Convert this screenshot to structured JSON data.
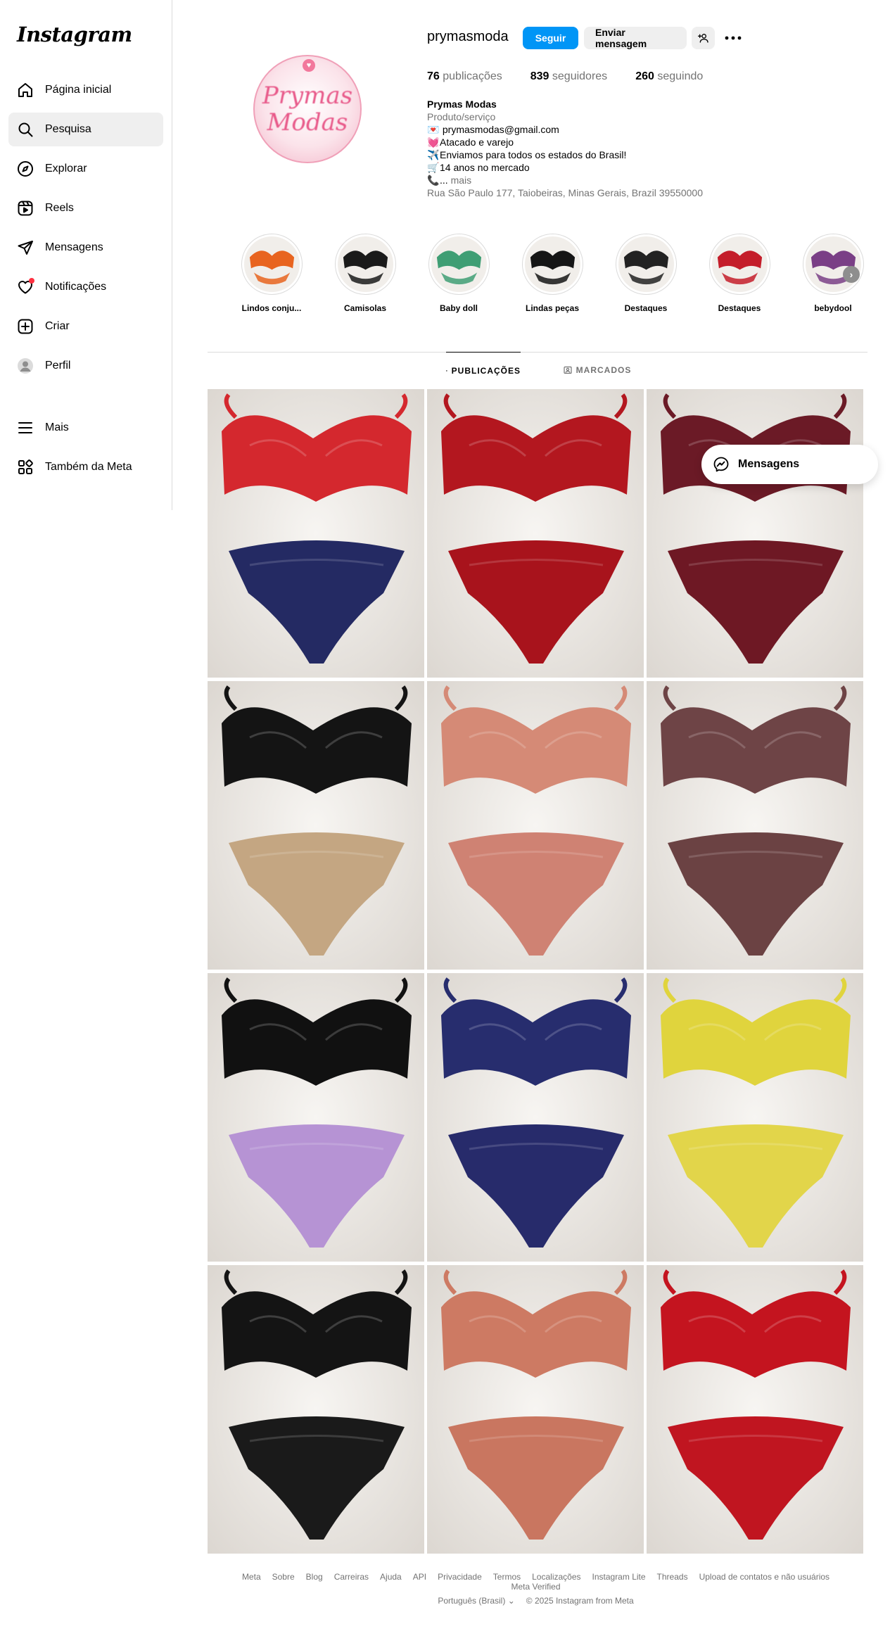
{
  "app": {
    "logo_text": "Instagram"
  },
  "sidebar": {
    "items": [
      {
        "label": "Página inicial",
        "icon": "home-icon"
      },
      {
        "label": "Pesquisa",
        "icon": "search-icon",
        "active": true
      },
      {
        "label": "Explorar",
        "icon": "compass-icon"
      },
      {
        "label": "Reels",
        "icon": "reels-icon"
      },
      {
        "label": "Mensagens",
        "icon": "paper-plane-icon"
      },
      {
        "label": "Notificações",
        "icon": "heart-icon"
      },
      {
        "label": "Criar",
        "icon": "plus-square-icon"
      },
      {
        "label": "Perfil",
        "icon": "avatar-icon"
      }
    ],
    "bottom_items": [
      {
        "label": "Mais",
        "icon": "menu-icon"
      },
      {
        "label": "Também da Meta",
        "icon": "meta-apps-icon"
      }
    ]
  },
  "profile": {
    "username": "prymasmoda",
    "avatar_text": [
      "Prymas",
      "Modas"
    ],
    "follow_label": "Seguir",
    "message_label": "Enviar mensagem",
    "stats": [
      {
        "value": "76",
        "label": "publicações"
      },
      {
        "value": "839",
        "label": "seguidores"
      },
      {
        "value": "260",
        "label": "seguindo"
      }
    ],
    "bio": {
      "name": "Prymas Modas",
      "category": "Produto/serviço",
      "lines": [
        {
          "emoji": "💌",
          "text": " prymasmodas@gmail.com"
        },
        {
          "emoji": "💓",
          "text": "Atacado e varejo"
        },
        {
          "emoji": "✈️",
          "text": "Enviamos para todos os estados do Brasil!"
        },
        {
          "emoji": "🛒",
          "text": "14 anos no mercado"
        }
      ],
      "more_emoji": "📞",
      "more_prefix": "... ",
      "more_label": "mais",
      "address": "Rua São Paulo 177, Taiobeiras, Minas Gerais, Brazil 39550000"
    }
  },
  "highlights": [
    {
      "label": "Lindos conju...",
      "color": "#e8641f"
    },
    {
      "label": "Camisolas",
      "color": "#1a1a1a"
    },
    {
      "label": "Baby doll",
      "color": "#3f9e74"
    },
    {
      "label": "Lindas peças",
      "color": "#151515"
    },
    {
      "label": "Destaques",
      "color": "#222222"
    },
    {
      "label": "Destaques",
      "color": "#c41d2a"
    },
    {
      "label": "bebydool",
      "color": "#7a3f86"
    }
  ],
  "tabs": {
    "posts": "PUBLICAÇÕES",
    "tagged": "MARCADOS"
  },
  "posts": [
    {
      "colors": [
        "#d4282e",
        "#242a63"
      ]
    },
    {
      "colors": [
        "#b3171f",
        "#a8131c"
      ]
    },
    {
      "colors": [
        "#6b1a26",
        "#6e1824"
      ]
    },
    {
      "colors": [
        "#141414",
        "#c4a682"
      ]
    },
    {
      "colors": [
        "#d58a76",
        "#cf8273"
      ]
    },
    {
      "colors": [
        "#6e4446",
        "#6b4243"
      ]
    },
    {
      "colors": [
        "#111111",
        "#b693d4"
      ]
    },
    {
      "colors": [
        "#272d6e",
        "#272b6b"
      ]
    },
    {
      "colors": [
        "#e0d43d",
        "#e2d54a"
      ]
    },
    {
      "colors": [
        "#141414",
        "#1a1a1a"
      ]
    },
    {
      "colors": [
        "#cd7a63",
        "#c97660"
      ]
    },
    {
      "colors": [
        "#c4141f",
        "#c01520"
      ]
    }
  ],
  "floating_messages": {
    "label": "Mensagens"
  },
  "footer": {
    "links": [
      "Meta",
      "Sobre",
      "Blog",
      "Carreiras",
      "Ajuda",
      "API",
      "Privacidade",
      "Termos",
      "Localizações",
      "Instagram Lite",
      "Threads",
      "Upload de contatos e não usuários",
      "Meta Verified"
    ],
    "language": "Português (Brasil)",
    "copyright": "© 2025 Instagram from Meta"
  },
  "colors": {
    "accent": "#0095f6",
    "secondary_button": "#efefef",
    "muted_text": "#737373",
    "border": "#dbdbdb",
    "notification": "#ff3040"
  }
}
